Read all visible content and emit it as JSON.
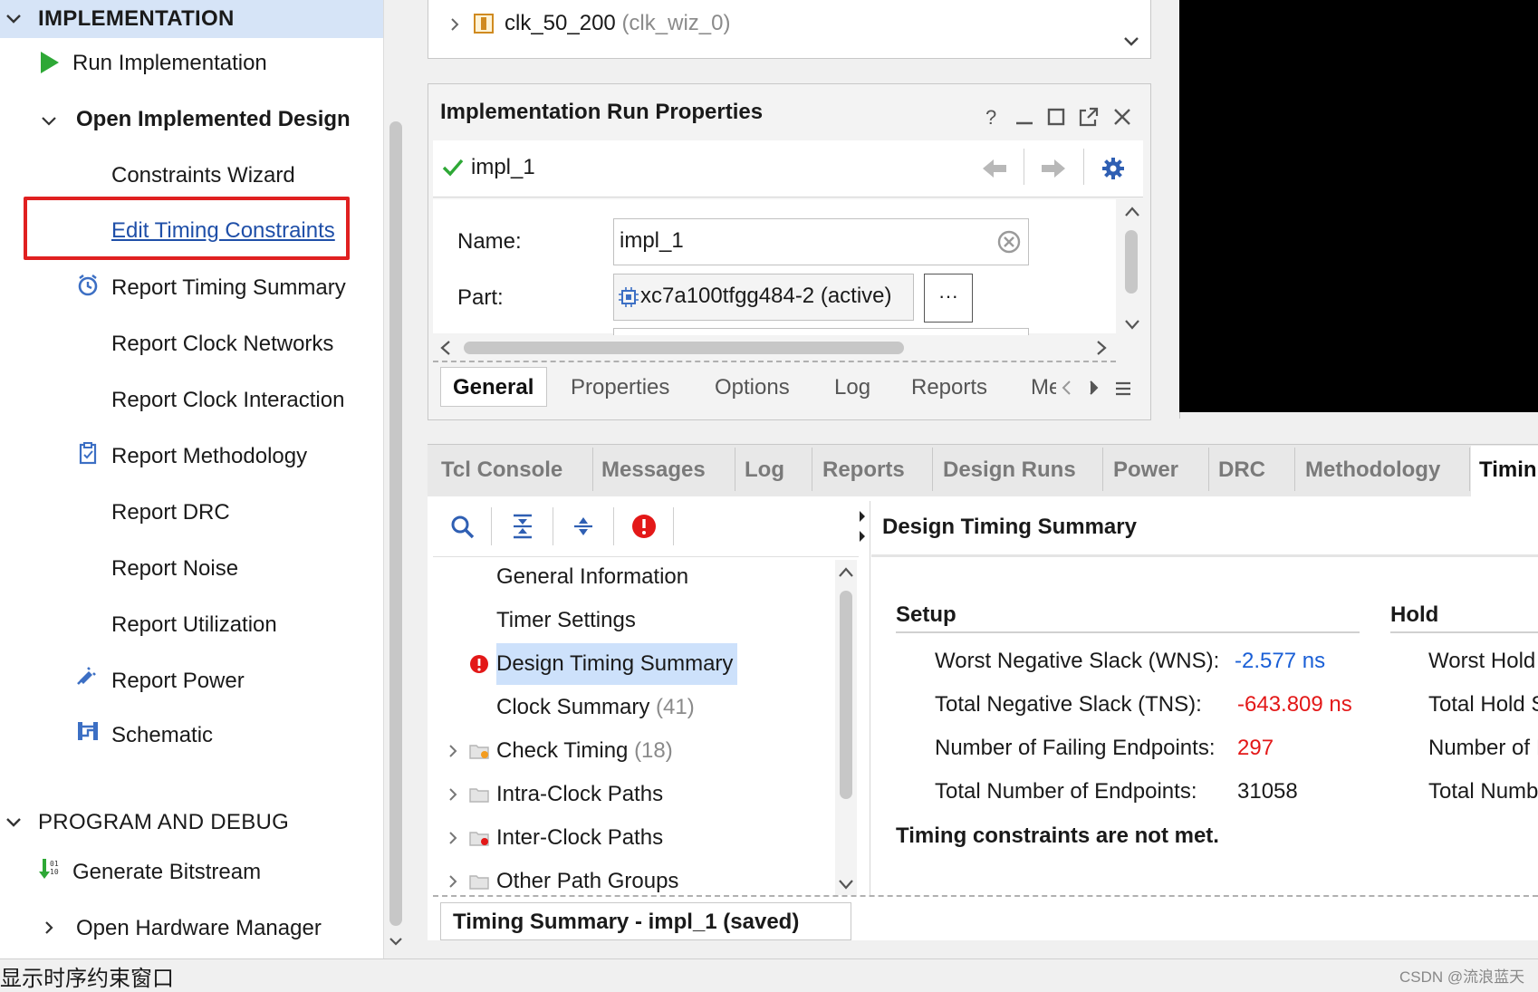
{
  "flow_navigator": {
    "implementation": {
      "header": "IMPLEMENTATION",
      "run": "Run Implementation",
      "open_design": "Open Implemented Design",
      "items": [
        "Constraints Wizard",
        "Edit Timing Constraints",
        "Report Timing Summary",
        "Report Clock Networks",
        "Report Clock Interaction",
        "Report Methodology",
        "Report DRC",
        "Report Noise",
        "Report Utilization",
        "Report Power",
        "Schematic"
      ]
    },
    "program_debug": {
      "header": "PROGRAM AND DEBUG",
      "generate": "Generate Bitstream",
      "hardware": "Open Hardware Manager"
    },
    "highlight_color": "#e02020"
  },
  "hierarchy": {
    "cell_name": "clk_50_200",
    "cell_module": "(clk_wiz_0)"
  },
  "run_properties": {
    "title": "Implementation Run Properties",
    "run_name": "impl_1",
    "name_label": "Name:",
    "name_value": "impl_1",
    "part_label": "Part:",
    "part_value": "xc7a100tfgg484-2 (active)",
    "browse_label": "···",
    "tabs": [
      "General",
      "Properties",
      "Options",
      "Log",
      "Reports",
      "Me"
    ],
    "active_tab": "General"
  },
  "bottom_tabs": [
    "Tcl Console",
    "Messages",
    "Log",
    "Reports",
    "Design Runs",
    "Power",
    "DRC",
    "Methodology",
    "Timin"
  ],
  "timing": {
    "tree": [
      {
        "label": "General Information",
        "count": ""
      },
      {
        "label": "Timer Settings",
        "count": ""
      },
      {
        "label": "Design Timing Summary",
        "count": ""
      },
      {
        "label": "Clock Summary",
        "count": "(41)"
      },
      {
        "label": "Check Timing",
        "count": "(18)"
      },
      {
        "label": "Intra-Clock Paths",
        "count": ""
      },
      {
        "label": "Inter-Clock Paths",
        "count": ""
      },
      {
        "label": "Other Path Groups",
        "count": ""
      }
    ],
    "summary_title": "Design Timing Summary",
    "setup_header": "Setup",
    "hold_header": "Hold",
    "setup_rows": [
      {
        "label": "Worst Negative Slack (WNS):",
        "value": "-2.577 ns"
      },
      {
        "label": "Total Negative Slack (TNS):",
        "value": "-643.809 ns"
      },
      {
        "label": "Number of Failing Endpoints:",
        "value": "297"
      },
      {
        "label": "Total Number of Endpoints:",
        "value": "31058"
      }
    ],
    "hold_rows": [
      "Worst Hold",
      "Total Hold S",
      "Number of I",
      "Total Numb"
    ],
    "message": "Timing constraints are not met.",
    "bottom_tab": "Timing Summary - impl_1 (saved)",
    "colors": {
      "link": "#1a5fd6",
      "error": "#e31818"
    }
  },
  "status_bar": {
    "caption": "显示时序约束窗口",
    "watermark": "CSDN @流浪蓝天"
  }
}
